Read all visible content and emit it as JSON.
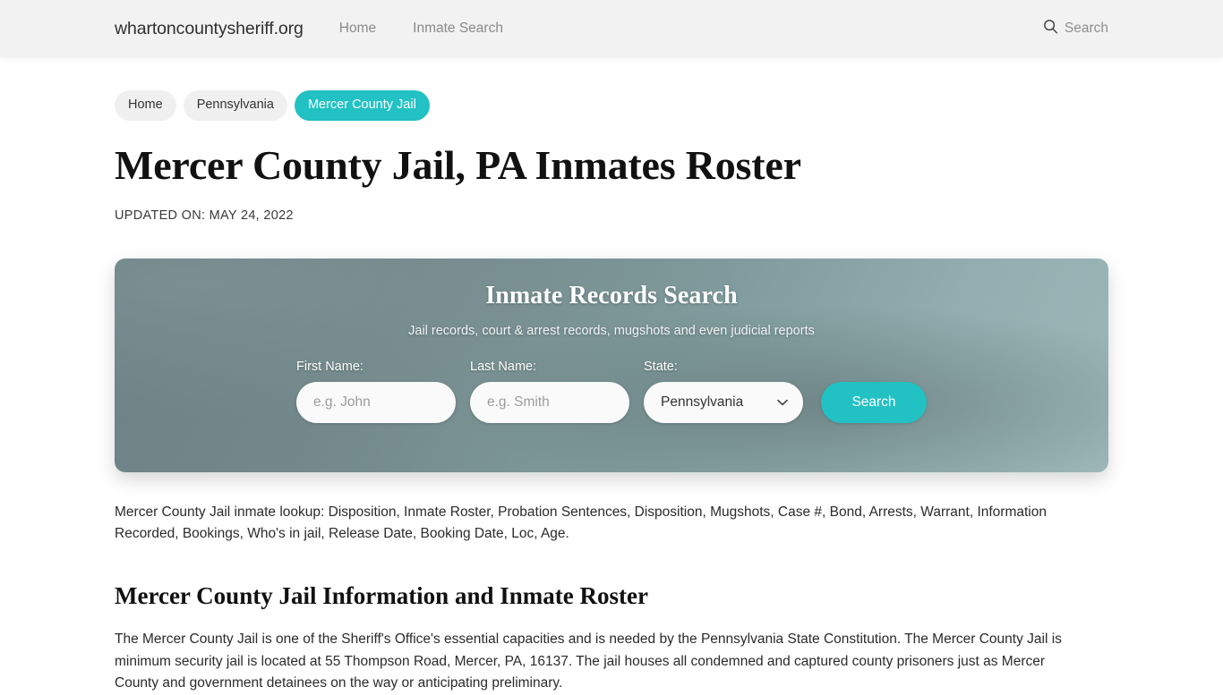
{
  "header": {
    "brand": "whartoncountysheriff.org",
    "nav": [
      {
        "label": "Home"
      },
      {
        "label": "Inmate Search"
      }
    ],
    "search": {
      "icon": "search-icon",
      "label": "Search"
    }
  },
  "breadcrumb": [
    {
      "label": "Home",
      "active": false
    },
    {
      "label": "Pennsylvania",
      "active": false
    },
    {
      "label": "Mercer County Jail",
      "active": true
    }
  ],
  "page": {
    "title": "Mercer County Jail, PA Inmates Roster",
    "updated_on": "UPDATED ON: MAY 24, 2022"
  },
  "search_card": {
    "title": "Inmate Records Search",
    "subtitle": "Jail records, court & arrest records, mugshots and even judicial reports",
    "first_name": {
      "label": "First Name:",
      "placeholder": "e.g. John",
      "value": ""
    },
    "last_name": {
      "label": "Last Name:",
      "placeholder": "e.g. Smith",
      "value": ""
    },
    "state": {
      "label": "State:",
      "selected": "Pennsylvania",
      "options": [
        "Pennsylvania"
      ],
      "chevron_icon": "chevron-down-icon"
    },
    "submit_label": "Search"
  },
  "main": {
    "lead_paragraph": "Mercer County Jail inmate lookup: Disposition, Inmate Roster, Probation Sentences, Disposition, Mugshots, Case #, Bond, Arrests, Warrant, Information Recorded, Bookings, Who's in jail, Release Date, Booking Date, Loc, Age.",
    "section_heading": "Mercer County Jail Information and Inmate Roster",
    "section_paragraph": "The Mercer County Jail is one of the Sheriff's Office's essential capacities and is needed by the Pennsylvania State Constitution. The Mercer County Jail is minimum security jail is located at 55 Thompson Road, Mercer, PA, 16137. The jail houses all condemned and captured county prisoners just as Mercer County and government detainees on the way or anticipating preliminary."
  },
  "colors": {
    "accent_teal": "#22c1c3",
    "header_bg": "#f2f2f2",
    "card_gradient_from": "#6c8184",
    "card_gradient_to": "#9db7b8",
    "page_bg": "#ffffff"
  }
}
